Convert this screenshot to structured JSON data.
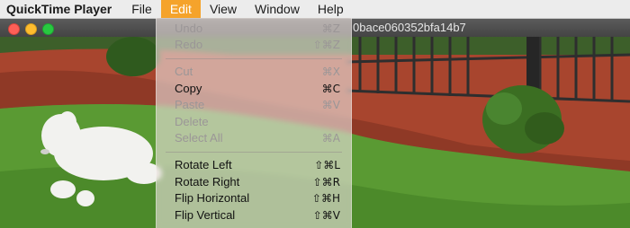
{
  "menubar": {
    "app_name": "QuickTime Player",
    "menus": [
      "File",
      "Edit",
      "View",
      "Window",
      "Help"
    ],
    "active_menu": "Edit",
    "highlight_color": "#f5a32b"
  },
  "window": {
    "title": "0bace060352bfa14b7"
  },
  "edit_menu": {
    "items": [
      {
        "label": "Undo",
        "shortcut": "⌘Z",
        "enabled": false
      },
      {
        "label": "Redo",
        "shortcut": "⇧⌘Z",
        "enabled": false
      },
      {
        "label": "Cut",
        "shortcut": "⌘X",
        "enabled": false
      },
      {
        "label": "Copy",
        "shortcut": "⌘C",
        "enabled": true
      },
      {
        "label": "Paste",
        "shortcut": "⌘V",
        "enabled": false
      },
      {
        "label": "Delete",
        "shortcut": "",
        "enabled": false
      },
      {
        "label": "Select All",
        "shortcut": "⌘A",
        "enabled": false
      },
      {
        "label": "Rotate Left",
        "shortcut": "⇧⌘L",
        "enabled": true
      },
      {
        "label": "Rotate Right",
        "shortcut": "⇧⌘R",
        "enabled": true
      },
      {
        "label": "Flip Horizontal",
        "shortcut": "⇧⌘H",
        "enabled": true
      },
      {
        "label": "Flip Vertical",
        "shortcut": "⇧⌘V",
        "enabled": true
      }
    ]
  },
  "colors": {
    "grass": "#4f8a2c",
    "mulch": "#a8452e",
    "fence": "#2e2e2e",
    "dog": "#f2f2ef"
  }
}
